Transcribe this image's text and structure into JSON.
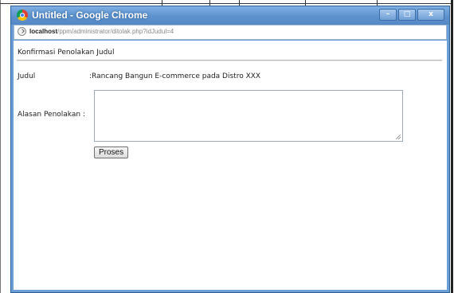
{
  "window": {
    "title": "Untitled - Google Chrome",
    "controls": {
      "minimize": "–",
      "maximize": "□",
      "close": "x"
    }
  },
  "addressbar": {
    "host": "localhost",
    "path": "/ppm/administrator/ditolak.php?idJudul=4"
  },
  "page": {
    "heading": "Konfirmasi Penolakan Judul",
    "judul_label": "Judul",
    "judul_value": ":Rancang Bangun E-commerce pada Distro XXX",
    "alasan_label": "Alasan Penolakan :",
    "alasan_value": "",
    "submit_label": "Proses"
  },
  "colors": {
    "titlebar": "#5d92cd",
    "window_border": "#2f5f95"
  }
}
